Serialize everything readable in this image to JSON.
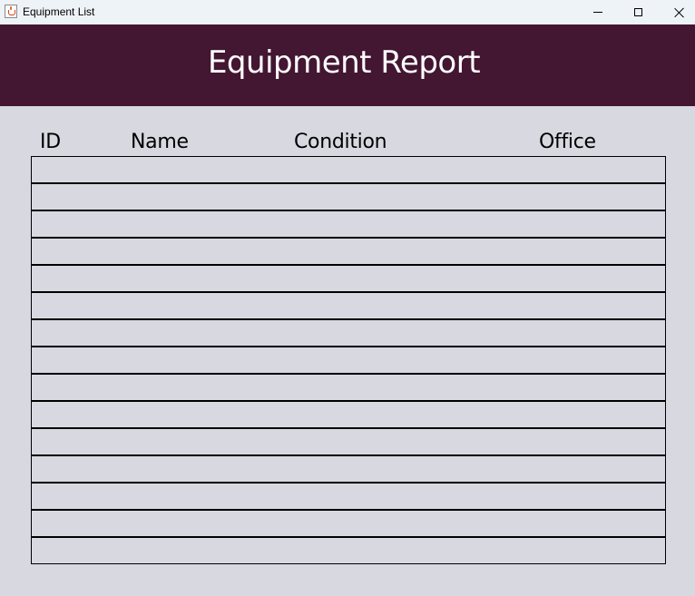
{
  "window": {
    "title": "Equipment List",
    "icon": "java-cup-icon",
    "controls": [
      "minimize",
      "maximize",
      "close"
    ]
  },
  "header": {
    "title": "Equipment Report",
    "background_color": "#431631",
    "text_color": "#ffffff"
  },
  "table": {
    "columns": [
      "ID",
      "Name",
      "Condition",
      "Office"
    ],
    "rows": [
      [
        "",
        "",
        "",
        ""
      ],
      [
        "",
        "",
        "",
        ""
      ],
      [
        "",
        "",
        "",
        ""
      ],
      [
        "",
        "",
        "",
        ""
      ],
      [
        "",
        "",
        "",
        ""
      ],
      [
        "",
        "",
        "",
        ""
      ],
      [
        "",
        "",
        "",
        ""
      ],
      [
        "",
        "",
        "",
        ""
      ],
      [
        "",
        "",
        "",
        ""
      ],
      [
        "",
        "",
        "",
        ""
      ],
      [
        "",
        "",
        "",
        ""
      ],
      [
        "",
        "",
        "",
        ""
      ],
      [
        "",
        "",
        "",
        ""
      ],
      [
        "",
        "",
        "",
        ""
      ],
      [
        "",
        "",
        "",
        ""
      ]
    ]
  },
  "colors": {
    "background": "#d8d9e0",
    "titlebar": "#eef3f8",
    "grid_lines": "#000000"
  }
}
